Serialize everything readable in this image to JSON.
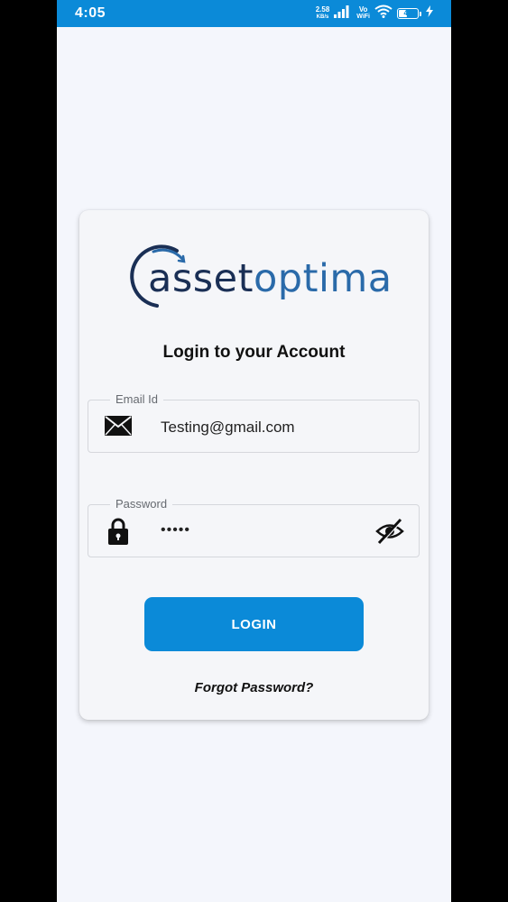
{
  "status_bar": {
    "time": "4:05",
    "net_speed_value": "2.58",
    "net_speed_unit": "KB/s",
    "vo_top": "Vo",
    "vo_bottom": "WiFi",
    "battery_level": "46",
    "battery_fraction": 0.46,
    "icons": [
      "signal-icon",
      "wifi-icon",
      "battery-icon",
      "charging-icon"
    ]
  },
  "logo": {
    "part1": "asset",
    "part2": "optima"
  },
  "login": {
    "title": "Login to your Account",
    "email": {
      "label": "Email Id",
      "value": "Testing@gmail.com",
      "icon": "mail-icon"
    },
    "password": {
      "label": "Password",
      "value": "•••••",
      "icon": "lock-icon",
      "toggle_icon": "eye-off-icon"
    },
    "button_label": "LOGIN",
    "forgot_label": "Forgot Password?"
  },
  "colors": {
    "primary": "#0b8ad8",
    "background": "#f4f6fc",
    "logo_dark": "#1a2f55",
    "logo_blue": "#2a6aa9"
  }
}
